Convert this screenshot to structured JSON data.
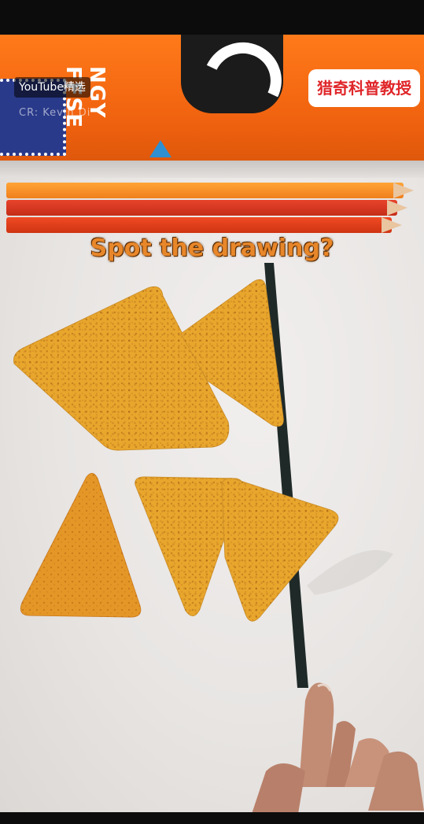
{
  "overlay": {
    "youtube_badge": "YouTube精选",
    "credit": "CR: Kevin Di",
    "channel_badge": "猎奇科普教授"
  },
  "bag": {
    "product_text": "NGY FFSE"
  },
  "caption": "Spot the drawing?",
  "colors": {
    "bag_orange": "#f0620f",
    "chip_yellow": "#e7a52b",
    "caption_orange": "#e8872a",
    "badge_red": "#e0262a"
  }
}
